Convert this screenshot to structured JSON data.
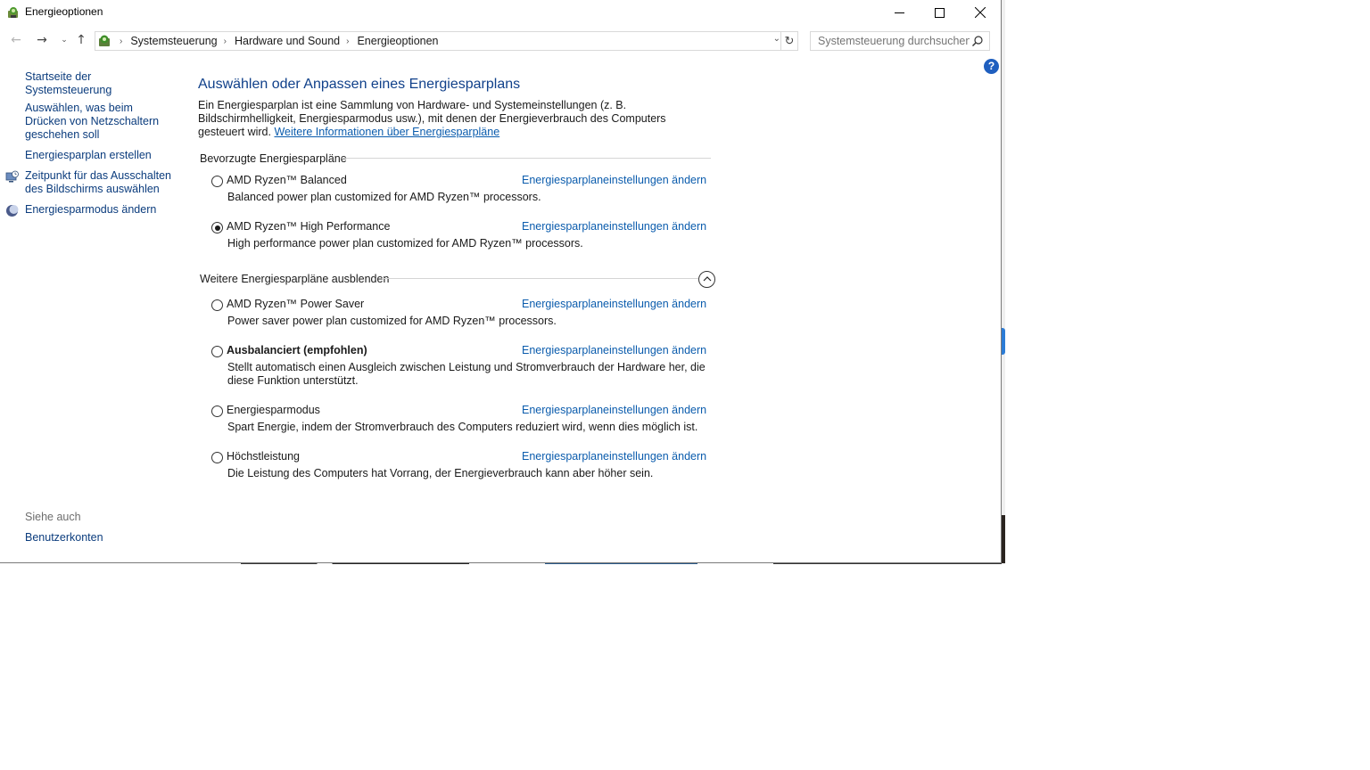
{
  "window": {
    "title": "Energieoptionen"
  },
  "titlebar": {
    "minimize_glyph": "—",
    "maximize_glyph": "☐",
    "close_glyph": "✕"
  },
  "nav": {
    "back_glyph": "←",
    "forward_glyph": "→",
    "recent_glyph": "⌄",
    "up_glyph": "↑",
    "breadcrumbs": [
      "Systemsteuerung",
      "Hardware und Sound",
      "Energieoptionen"
    ],
    "separator": "›",
    "refresh_glyph": "↻",
    "dropdown_glyph": "⌄"
  },
  "search": {
    "placeholder": "Systemsteuerung durchsuchen"
  },
  "help": {
    "glyph": "?"
  },
  "sidebar": {
    "items": [
      {
        "label": "Startseite der Systemsteuerung"
      },
      {
        "label": "Auswählen, was beim Drücken von Netzschaltern geschehen soll"
      },
      {
        "label": "Energiesparplan erstellen"
      },
      {
        "label": "Zeitpunkt für das Ausschalten des Bildschirms auswählen",
        "icon": "display-clock-icon"
      },
      {
        "label": "Energiesparmodus ändern",
        "icon": "moon-icon"
      }
    ],
    "see_also_label": "Siehe auch",
    "see_also_items": [
      {
        "label": "Benutzerkonten"
      }
    ]
  },
  "main": {
    "title": "Auswählen oder Anpassen eines Energiesparplans",
    "description": "Ein Energiesparplan ist eine Sammlung von Hardware- und Systemeinstellungen (z. B. Bildschirmhelligkeit, Energiesparmodus usw.), mit denen der Energieverbrauch des Computers gesteuert wird.",
    "more_info_link": "Weitere Informationen über Energiesparpläne",
    "preferred_header": "Bevorzugte Energiesparpläne",
    "hidden_header": "Weitere Energiesparpläne ausblenden",
    "change_link": "Energiesparplaneinstellungen ändern",
    "preferred_plans": [
      {
        "name": "AMD Ryzen™ Balanced",
        "description": "Balanced power plan customized for AMD Ryzen™ processors.",
        "selected": false
      },
      {
        "name": "AMD Ryzen™ High Performance",
        "description": "High performance power plan customized for AMD Ryzen™ processors.",
        "selected": true
      }
    ],
    "other_plans": [
      {
        "name": "AMD Ryzen™ Power Saver",
        "description": "Power saver power plan customized for AMD Ryzen™ processors.",
        "selected": false
      },
      {
        "name": "Ausbalanciert (empfohlen)",
        "description": "Stellt automatisch einen Ausgleich zwischen Leistung und Stromverbrauch der Hardware her, die diese Funktion unterstützt.",
        "selected": false
      },
      {
        "name": "Energiesparmodus",
        "description": "Spart Energie, indem der Stromverbrauch des Computers reduziert wird, wenn dies möglich ist.",
        "selected": false
      },
      {
        "name": "Höchstleistung",
        "description": "Die Leistung des Computers hat Vorrang, der Energieverbrauch kann aber höher sein.",
        "selected": false
      }
    ],
    "collapse_glyph": "︿"
  },
  "colors": {
    "link": "#0b5cad",
    "title_blue": "#10408a",
    "help_blue": "#1f5fbf"
  }
}
